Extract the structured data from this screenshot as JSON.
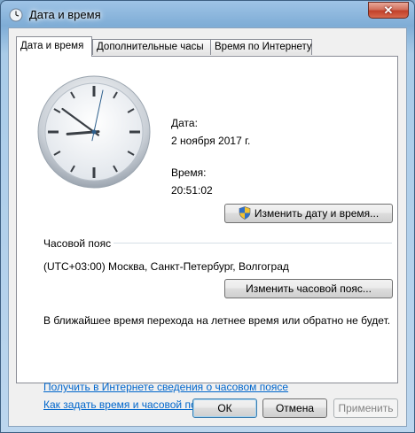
{
  "window": {
    "title": "Дата и время",
    "close_glyph": "✕"
  },
  "tabs": [
    {
      "label": "Дата и время",
      "active": true
    },
    {
      "label": "Дополнительные часы",
      "active": false
    },
    {
      "label": "Время по Интернету",
      "active": false
    }
  ],
  "clock": {
    "hour": 20,
    "minute": 51,
    "second": 2
  },
  "date": {
    "label": "Дата:",
    "value": "2 ноября 2017 г."
  },
  "time": {
    "label": "Время:",
    "value": "20:51:02"
  },
  "change_datetime_button": "Изменить дату и время...",
  "timezone": {
    "heading": "Часовой пояс",
    "value": "(UTC+03:00) Москва, Санкт-Петербург, Волгоград",
    "change_button": "Изменить часовой пояс...",
    "dst_note": "В ближайшее время перехода на летнее время или обратно не будет."
  },
  "links": {
    "online_info": "Получить в Интернете сведения о часовом поясе",
    "how_to_set": "Как задать время и часовой пояс?"
  },
  "footer": {
    "ok": "ОК",
    "cancel": "Отмена",
    "apply": "Применить"
  }
}
